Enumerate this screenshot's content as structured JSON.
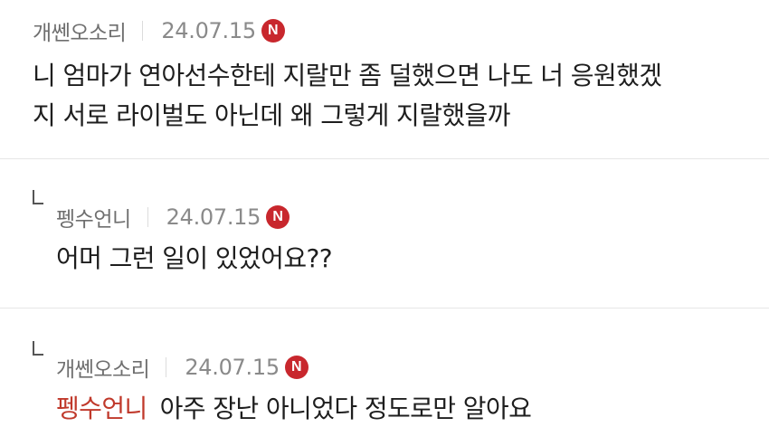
{
  "comments": [
    {
      "author": "개쎈오소리",
      "date": "24.07.15",
      "badge": "N",
      "lines": [
        "니 엄마가 연아선수한테 지랄만 좀 덜했으면 나도 너 응원했겠",
        "지 서로 라이벌도 아닌데 왜 그렇게 지랄했을까"
      ]
    },
    {
      "author": "펭수언니",
      "date": "24.07.15",
      "badge": "N",
      "text": "어머 그런 일이 있었어요??"
    },
    {
      "author": "개쎈오소리",
      "date": "24.07.15",
      "badge": "N",
      "mention": "펭수언니",
      "text": "아주 장난 아니었다 정도로만 알아요"
    }
  ],
  "colors": {
    "badge": "#c8272d",
    "mention": "#c0392b",
    "divider": "#e6e6e6"
  }
}
